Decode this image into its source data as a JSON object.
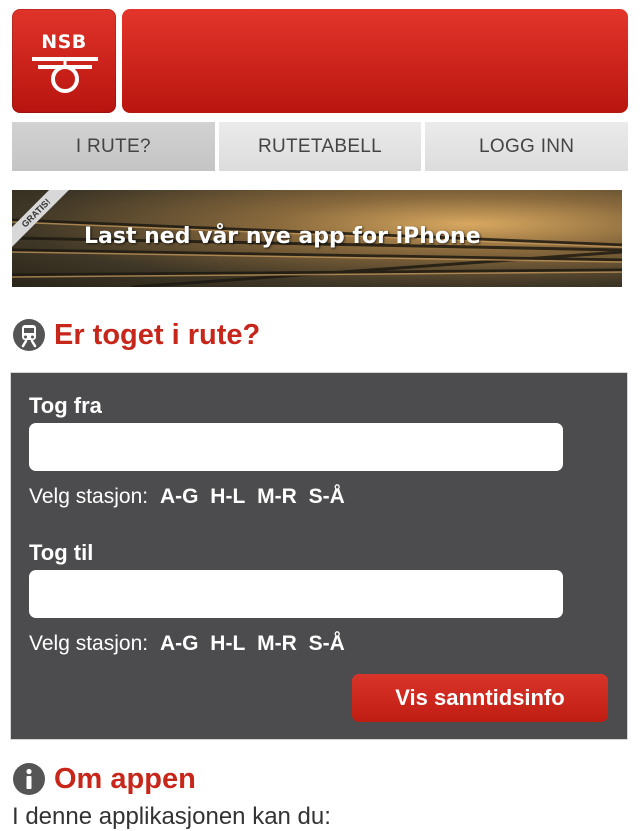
{
  "header": {
    "logo_text": "NSB",
    "brand_color": "#d0261b"
  },
  "tabs": [
    {
      "label": "I RUTE?",
      "active": true
    },
    {
      "label": "RUTETABELL",
      "active": false
    },
    {
      "label": "LOGG INN",
      "active": false
    }
  ],
  "banner": {
    "ribbon": "GRATIS!",
    "text": "Last ned vår nye app for iPhone"
  },
  "section_route": {
    "icon": "train-icon",
    "title": "Er toget i rute?"
  },
  "form": {
    "from_label": "Tog fra",
    "from_value": "",
    "to_label": "Tog til",
    "to_value": "",
    "station_prompt": "Velg stasjon:",
    "ranges": [
      "A-G",
      "H-L",
      "M-R",
      "S-Å"
    ],
    "submit_label": "Vis sanntidsinfo"
  },
  "section_about": {
    "icon": "info-icon",
    "title": "Om appen",
    "intro": "I denne applikasjonen kan du:"
  }
}
